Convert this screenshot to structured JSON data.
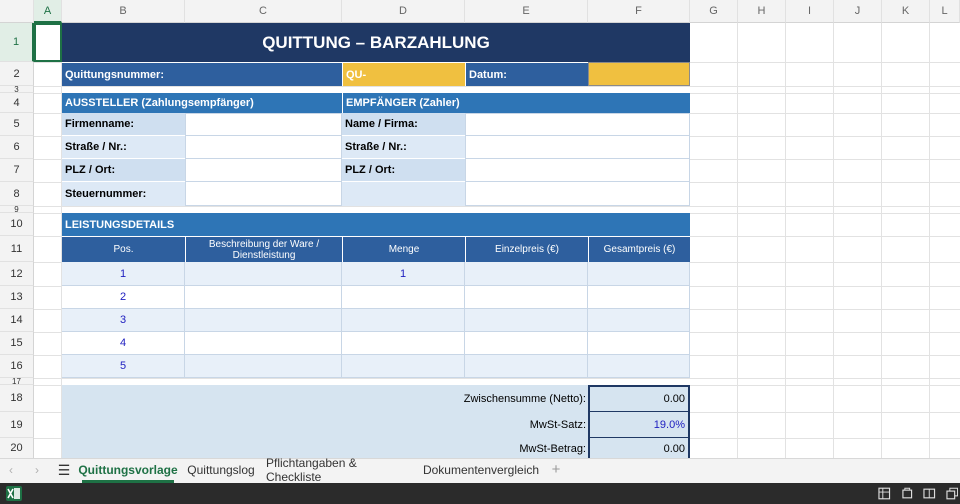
{
  "columns": [
    "A",
    "B",
    "C",
    "D",
    "E",
    "F",
    "G",
    "H",
    "I",
    "J",
    "K",
    "L"
  ],
  "rows": [
    "1",
    "2",
    "3",
    "4",
    "5",
    "6",
    "7",
    "8",
    "9",
    "10",
    "11",
    "12",
    "13",
    "14",
    "15",
    "16",
    "17",
    "18",
    "19",
    "20"
  ],
  "title": "QUITTUNG – BARZAHLUNG",
  "receipt": {
    "number_label": "Quittungsnummer:",
    "number_value": "QU-",
    "date_label": "Datum:",
    "date_value": ""
  },
  "issuer": {
    "header": "AUSSTELLER (Zahlungsempfänger)",
    "fields": [
      "Firmenname:",
      "Straße / Nr.:",
      "PLZ / Ort:",
      "Steuernummer:"
    ]
  },
  "recipient": {
    "header": "EMPFÄNGER (Zahler)",
    "fields": [
      "Name / Firma:",
      "Straße / Nr.:",
      "PLZ / Ort:"
    ]
  },
  "details": {
    "header": "LEISTUNGSDETAILS",
    "columns": [
      "Pos.",
      "Beschreibung der Ware / Dienstleistung",
      "Menge",
      "Einzelpreis (€)",
      "Gesamtpreis (€)"
    ],
    "items": [
      {
        "pos": "1",
        "desc": "",
        "qty": "1",
        "unit": "",
        "total": ""
      },
      {
        "pos": "2",
        "desc": "",
        "qty": "",
        "unit": "",
        "total": ""
      },
      {
        "pos": "3",
        "desc": "",
        "qty": "",
        "unit": "",
        "total": ""
      },
      {
        "pos": "4",
        "desc": "",
        "qty": "",
        "unit": "",
        "total": ""
      },
      {
        "pos": "5",
        "desc": "",
        "qty": "",
        "unit": "",
        "total": ""
      }
    ]
  },
  "totals": {
    "subtotal_label": "Zwischensumme (Netto):",
    "subtotal_value": "0.00",
    "vat_rate_label": "MwSt-Satz:",
    "vat_rate_value": "19.0%",
    "vat_amount_label": "MwSt-Betrag:",
    "vat_amount_value": "0.00"
  },
  "sheets": {
    "tabs": [
      "Quittungsvorlage",
      "Quittungslog",
      "Pflichtangaben & Checkliste",
      "Dokumentenvergleich"
    ],
    "active": "Quittungsvorlage"
  },
  "colors": {
    "navy": "#1f3864",
    "blue": "#2e75b6",
    "gold": "#f0c040",
    "label": "#cfdff0",
    "sheet_green": "#1e7145"
  },
  "icons": [
    "excel-icon",
    "menu-icon",
    "add-sheet-icon",
    "nav-prev-icon",
    "nav-next-icon"
  ]
}
